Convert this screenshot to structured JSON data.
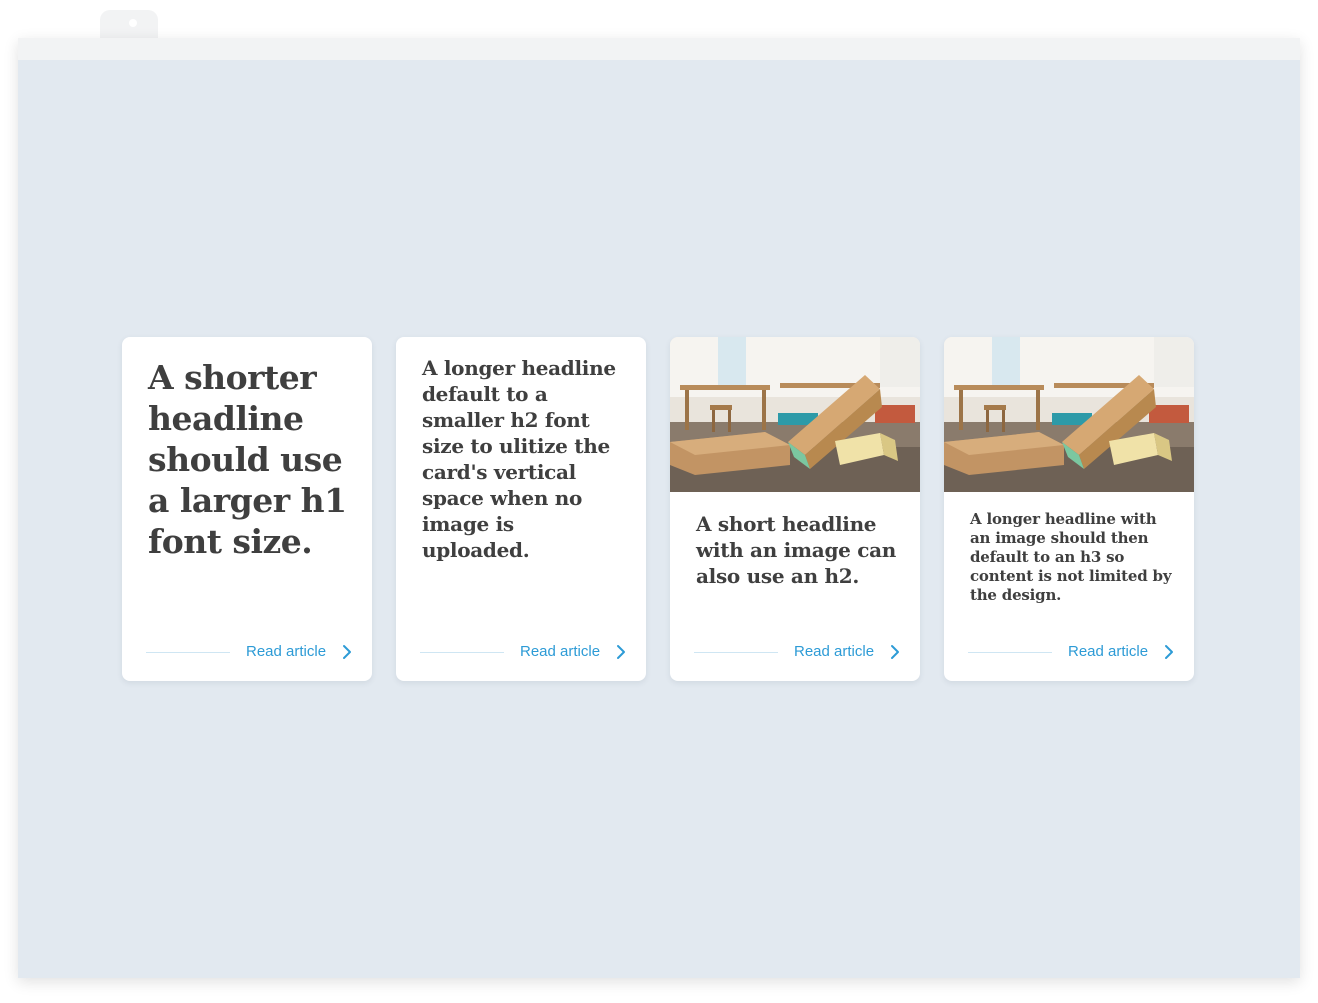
{
  "colors": {
    "page_background": "#e2e9f0",
    "card_background": "#ffffff",
    "headline": "#3f3f3f",
    "link_accent": "#2d9bd6"
  },
  "cards": [
    {
      "headline": "A shorter headline should use a larger h1 font size.",
      "link_label": "Read article",
      "link_icon": "chevron-right-icon",
      "has_image": false
    },
    {
      "headline": "A longer headline default to a smaller h2 font size to ulitize the card's vertical space when no image is uploaded.",
      "link_label": "Read article",
      "link_icon": "chevron-right-icon",
      "has_image": false
    },
    {
      "headline": "A short headline with an image can also use an h2.",
      "link_label": "Read article",
      "link_icon": "chevron-right-icon",
      "has_image": true
    },
    {
      "headline": "A longer headline with an image should then default to an h3 so content is not limited by the design.",
      "link_label": "Read article",
      "link_icon": "chevron-right-icon",
      "has_image": true
    }
  ]
}
